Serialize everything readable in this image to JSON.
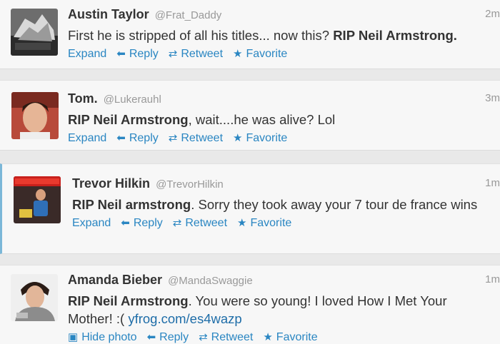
{
  "tweets": [
    {
      "fullname": "Austin Taylor",
      "handle": "@Frat_Daddy",
      "time": "2m",
      "text_plain": "First he is stripped of all his titles... now this? ",
      "text_bold": "RIP Neil Armstrong.",
      "text_after": "",
      "link": "",
      "expand_label": "Expand"
    },
    {
      "fullname": "Tom.",
      "handle": "@Lukerauhl",
      "time": "3m",
      "text_plain": "",
      "text_bold": "RIP Neil Armstrong",
      "text_after": ", wait....he was alive? Lol",
      "link": "",
      "expand_label": "Expand"
    },
    {
      "fullname": "Trevor Hilkin",
      "handle": "@TrevorHilkin",
      "time": "1m",
      "text_plain": "",
      "text_bold": "RIP Neil armstrong",
      "text_after": ". Sorry they took away your 7 tour de france wins",
      "link": "",
      "expand_label": "Expand"
    },
    {
      "fullname": "Amanda Bieber",
      "handle": "@MandaSwaggie",
      "time": "1m",
      "text_plain": "",
      "text_bold": "RIP Neil Armstrong",
      "text_after": ". You were so young! I loved How I Met Your Mother! :( ",
      "link": "yfrog.com/es4wazp",
      "expand_label": "Hide photo"
    }
  ],
  "actions": {
    "reply": "Reply",
    "retweet": "Retweet",
    "favorite": "Favorite"
  },
  "icons": {
    "reply": "reply-arrow-icon",
    "retweet": "retweet-icon",
    "favorite": "star-icon",
    "photo": "photo-icon"
  },
  "colors": {
    "link": "#2a86c2",
    "name": "#333333",
    "meta": "#999999",
    "highlight_border": "#7bb7d8"
  }
}
